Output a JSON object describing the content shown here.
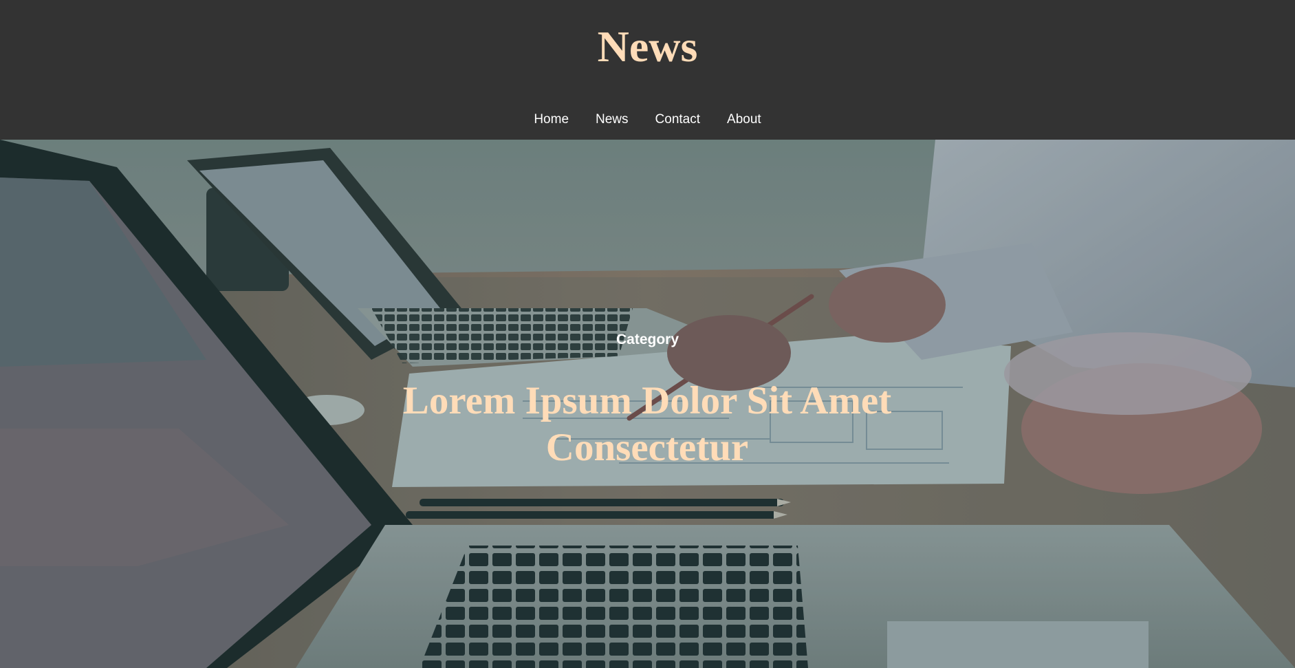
{
  "header": {
    "title": "News"
  },
  "nav": {
    "items": [
      {
        "label": "Home"
      },
      {
        "label": "News"
      },
      {
        "label": "Contact"
      },
      {
        "label": "About"
      }
    ]
  },
  "hero": {
    "category": "Category",
    "headline": "Lorem Ipsum Dolor Sit Amet Consectetur",
    "background_image": "laptops-on-desk-photo"
  },
  "colors": {
    "header_bg": "#333333",
    "title": "#ffdcb8",
    "nav_text": "#ffffff",
    "headline": "#ffdcb8",
    "category_text": "#ffffff"
  }
}
